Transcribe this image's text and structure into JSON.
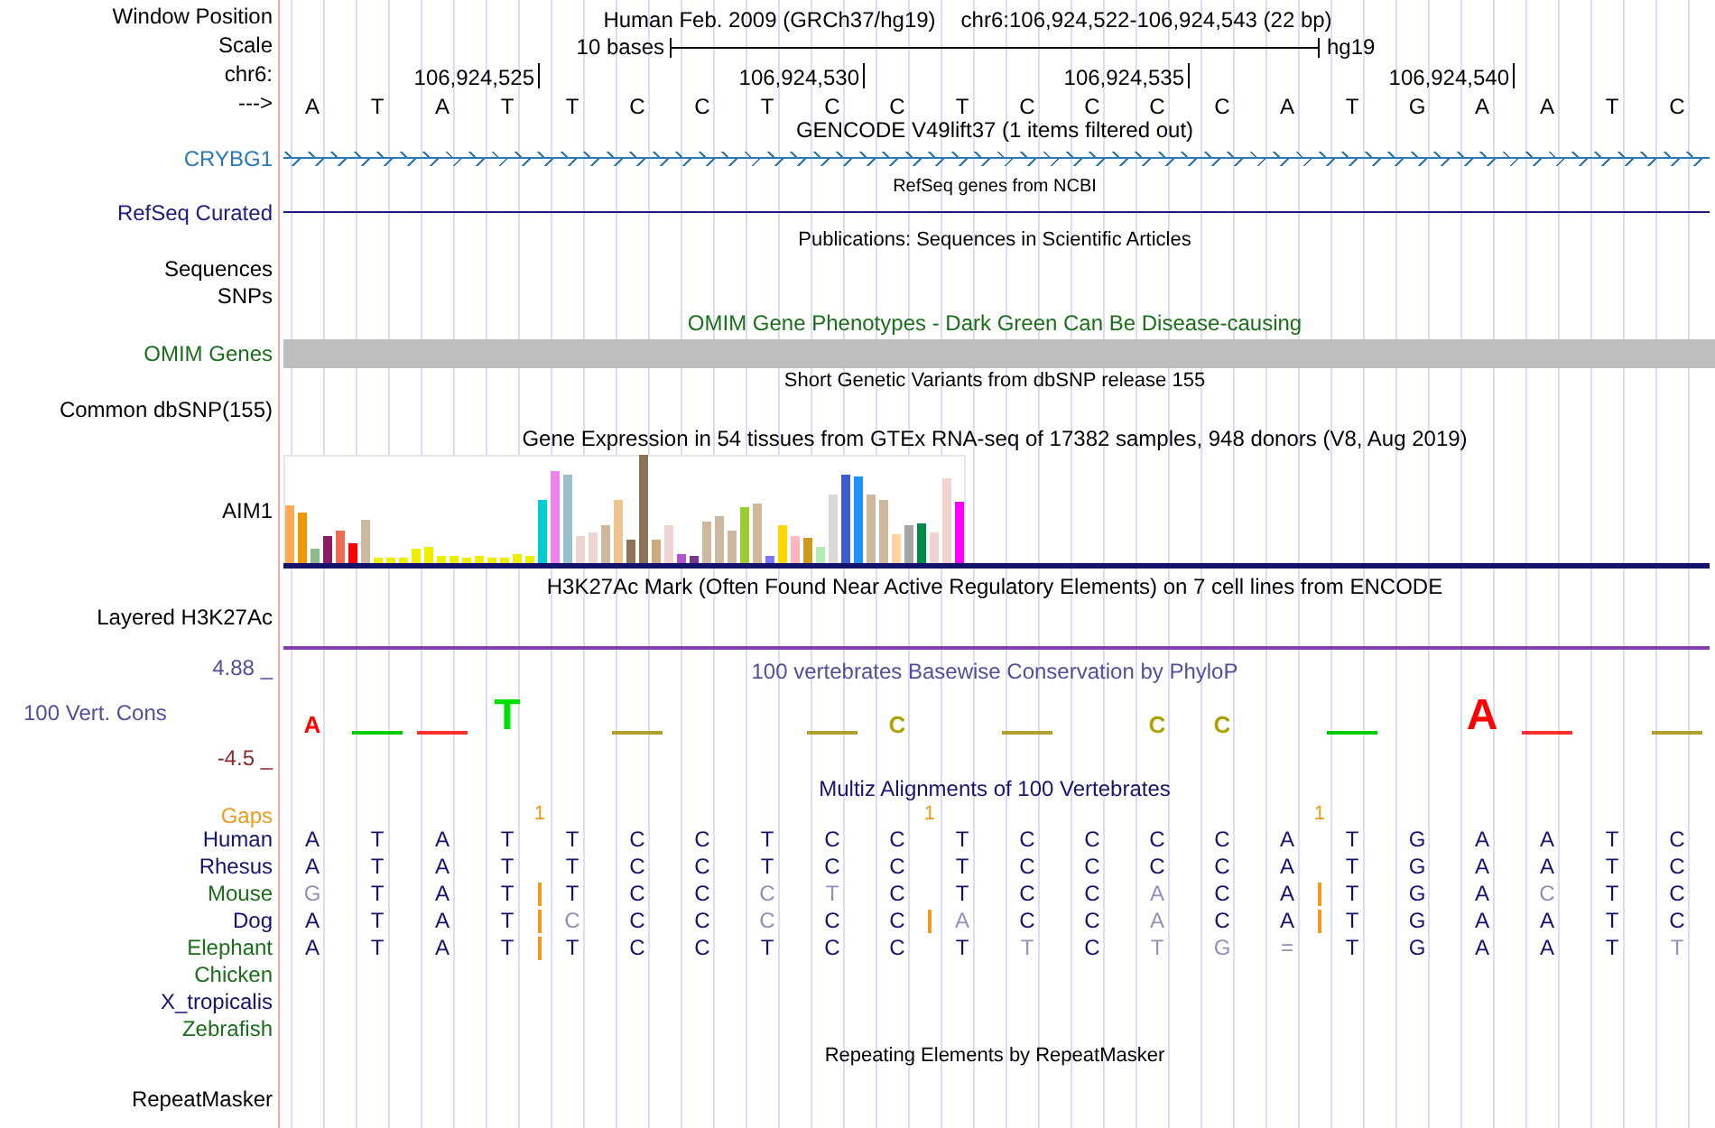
{
  "header": {
    "label": "Window Position",
    "assembly": "Human Feb. 2009 (GRCh37/hg19)",
    "position": "chr6:106,924,522-106,924,543 (22 bp)"
  },
  "scale": {
    "label": "Scale",
    "length": "10 bases",
    "assembly": "hg19"
  },
  "ruler": {
    "label": "chr6:",
    "ticks": [
      "106,924,525",
      "106,924,530",
      "106,924,535",
      "106,924,540"
    ]
  },
  "sequence": {
    "label": "--->",
    "bases": [
      "A",
      "T",
      "A",
      "T",
      "T",
      "C",
      "C",
      "T",
      "C",
      "C",
      "T",
      "C",
      "C",
      "C",
      "C",
      "A",
      "T",
      "G",
      "A",
      "A",
      "T",
      "C"
    ]
  },
  "tracks": [
    {
      "kind": "gene",
      "title": "GENCODE V49lift37 (1 items filtered out)",
      "labels": [
        "CRYBG1"
      ],
      "color": "#2a78b4"
    },
    {
      "kind": "line",
      "title": "RefSeq genes from NCBI",
      "labels": [
        "RefSeq Curated"
      ],
      "color": "#1c1c80"
    },
    {
      "kind": "empty",
      "title": "Publications: Sequences in Scientific Articles",
      "labels": [
        "Sequences",
        "SNPs"
      ],
      "color": "#000000"
    },
    {
      "kind": "bar",
      "title": "OMIM Gene Phenotypes - Dark Green Can Be Disease-causing",
      "labels": [
        "OMIM Genes"
      ],
      "color": "#1a6e1a"
    },
    {
      "kind": "empty",
      "title": "Short Genetic Variants from dbSNP release 155",
      "labels": [
        "Common dbSNP(155)"
      ],
      "color": "#000000"
    },
    {
      "kind": "expression",
      "title": "Gene Expression in 54 tissues from GTEx RNA-seq of 17382 samples, 948 donors (V8, Aug 2019)",
      "labels": [
        "AIM1"
      ],
      "color": "#000000"
    },
    {
      "kind": "layered",
      "title": "H3K27Ac Mark (Often Found Near Active Regulatory Elements) on 7 cell lines from ENCODE",
      "labels": [
        "Layered H3K27Ac"
      ],
      "color": "#000000"
    },
    {
      "kind": "conservation",
      "title": "100 vertebrates Basewise Conservation by PhyloP",
      "labels": [
        "100 Vert. Cons"
      ],
      "color": "#4f4f9c",
      "max": "4.88 _",
      "min": "-4.5 _",
      "logo": [
        {
          "kind": "letter",
          "letter": "A",
          "color": "#ff0000"
        },
        {
          "kind": "dash",
          "color": "#00cc00"
        },
        {
          "kind": "dash",
          "color": "#ff3030"
        },
        {
          "kind": "big",
          "letter": "T",
          "color": "#00e000"
        },
        {
          "kind": "blank"
        },
        {
          "kind": "dash",
          "color": "#b0a030"
        },
        {
          "kind": "blank"
        },
        {
          "kind": "blank"
        },
        {
          "kind": "dash",
          "color": "#b0a030"
        },
        {
          "kind": "letter",
          "letter": "C",
          "color": "#b0a000"
        },
        {
          "kind": "blank"
        },
        {
          "kind": "dash",
          "color": "#b0a030"
        },
        {
          "kind": "blank"
        },
        {
          "kind": "letter",
          "letter": "C",
          "color": "#b0a000"
        },
        {
          "kind": "letter",
          "letter": "C",
          "color": "#b0a000"
        },
        {
          "kind": "blank"
        },
        {
          "kind": "dash",
          "color": "#00cc00"
        },
        {
          "kind": "blank"
        },
        {
          "kind": "big",
          "letter": "A",
          "color": "#ff0000"
        },
        {
          "kind": "dash",
          "color": "#ff3030"
        },
        {
          "kind": "blank"
        },
        {
          "kind": "dash",
          "color": "#b0a030"
        }
      ]
    },
    {
      "kind": "alignment",
      "title": "Multiz Alignments of 100 Vertebrates",
      "labels": [
        "Gaps"
      ],
      "color": "#ee9a1a",
      "gaps": [
        {
          "kind": "none"
        },
        {
          "kind": "none"
        },
        {
          "kind": "none"
        },
        {
          "kind": "gap",
          "count": "1"
        },
        {
          "kind": "none"
        },
        {
          "kind": "none"
        },
        {
          "kind": "none"
        },
        {
          "kind": "none"
        },
        {
          "kind": "none"
        },
        {
          "kind": "gap",
          "count": "1"
        },
        {
          "kind": "none"
        },
        {
          "kind": "none"
        },
        {
          "kind": "none"
        },
        {
          "kind": "none"
        },
        {
          "kind": "none"
        },
        {
          "kind": "gap",
          "count": "1"
        },
        {
          "kind": "none"
        },
        {
          "kind": "none"
        },
        {
          "kind": "none"
        },
        {
          "kind": "none"
        },
        {
          "kind": "none"
        },
        {
          "kind": "none"
        }
      ],
      "species": [
        {
          "name": "Human",
          "color": "#14146e",
          "bases": [
            "A",
            "T",
            "A",
            "T",
            "T",
            "C",
            "C",
            "T",
            "C",
            "C",
            "T",
            "C",
            "C",
            "C",
            "C",
            "A",
            "T",
            "G",
            "A",
            "A",
            "T",
            "C"
          ],
          "mismatch": [
            false,
            false,
            false,
            false,
            false,
            false,
            false,
            false,
            false,
            false,
            false,
            false,
            false,
            false,
            false,
            false,
            false,
            false,
            false,
            false,
            false,
            false
          ],
          "insertion_after": [
            false,
            false,
            false,
            false,
            false,
            false,
            false,
            false,
            false,
            false,
            false,
            false,
            false,
            false,
            false,
            false,
            false,
            false,
            false,
            false,
            false,
            false
          ]
        },
        {
          "name": "Rhesus",
          "color": "#14146e",
          "bases": [
            "A",
            "T",
            "A",
            "T",
            "T",
            "C",
            "C",
            "T",
            "C",
            "C",
            "T",
            "C",
            "C",
            "C",
            "C",
            "A",
            "T",
            "G",
            "A",
            "A",
            "T",
            "C"
          ],
          "mismatch": [
            false,
            false,
            false,
            false,
            false,
            false,
            false,
            false,
            false,
            false,
            false,
            false,
            false,
            false,
            false,
            false,
            false,
            false,
            false,
            false,
            false,
            false
          ],
          "insertion_after": [
            false,
            false,
            false,
            false,
            false,
            false,
            false,
            false,
            false,
            false,
            false,
            false,
            false,
            false,
            false,
            false,
            false,
            false,
            false,
            false,
            false,
            false
          ]
        },
        {
          "name": "Mouse",
          "color": "#1a6e1a",
          "bases": [
            "G",
            "T",
            "A",
            "T",
            "T",
            "C",
            "C",
            "C",
            "T",
            "C",
            "T",
            "C",
            "C",
            "A",
            "C",
            "A",
            "T",
            "G",
            "A",
            "C",
            "T",
            "C"
          ],
          "mismatch": [
            true,
            false,
            false,
            false,
            false,
            false,
            false,
            true,
            true,
            false,
            false,
            false,
            false,
            true,
            false,
            false,
            false,
            false,
            false,
            true,
            false,
            false
          ],
          "insertion_after": [
            false,
            false,
            false,
            true,
            false,
            false,
            false,
            false,
            false,
            false,
            false,
            false,
            false,
            false,
            false,
            true,
            false,
            false,
            false,
            false,
            false,
            false
          ]
        },
        {
          "name": "Dog",
          "color": "#14146e",
          "bases": [
            "A",
            "T",
            "A",
            "T",
            "C",
            "C",
            "C",
            "C",
            "C",
            "C",
            "A",
            "C",
            "C",
            "A",
            "C",
            "A",
            "T",
            "G",
            "A",
            "A",
            "T",
            "C"
          ],
          "mismatch": [
            false,
            false,
            false,
            false,
            true,
            false,
            false,
            true,
            false,
            false,
            true,
            false,
            false,
            true,
            false,
            false,
            false,
            false,
            false,
            false,
            false,
            false
          ],
          "insertion_after": [
            false,
            false,
            false,
            true,
            false,
            false,
            false,
            false,
            false,
            true,
            false,
            false,
            false,
            false,
            false,
            true,
            false,
            false,
            false,
            false,
            false,
            false
          ]
        },
        {
          "name": "Elephant",
          "color": "#1a6e1a",
          "bases": [
            "A",
            "T",
            "A",
            "T",
            "T",
            "C",
            "C",
            "T",
            "C",
            "C",
            "T",
            "T",
            "C",
            "T",
            "G",
            "=",
            "T",
            "G",
            "A",
            "A",
            "T",
            "T"
          ],
          "mismatch": [
            false,
            false,
            false,
            false,
            false,
            false,
            false,
            false,
            false,
            false,
            false,
            true,
            false,
            true,
            true,
            true,
            false,
            false,
            false,
            false,
            false,
            true
          ],
          "insertion_after": [
            false,
            false,
            false,
            true,
            false,
            false,
            false,
            false,
            false,
            false,
            false,
            false,
            false,
            false,
            false,
            false,
            false,
            false,
            false,
            false,
            false,
            false
          ]
        },
        {
          "name": "Chicken",
          "color": "#1a6e1a"
        },
        {
          "name": "X_tropicalis",
          "color": "#14146e"
        },
        {
          "name": "Zebrafish",
          "color": "#1a6e1a"
        }
      ]
    },
    {
      "kind": "empty",
      "title": "Repeating Elements by RepeatMasker",
      "labels": [
        "RepeatMasker"
      ],
      "color": "#000000"
    }
  ]
}
